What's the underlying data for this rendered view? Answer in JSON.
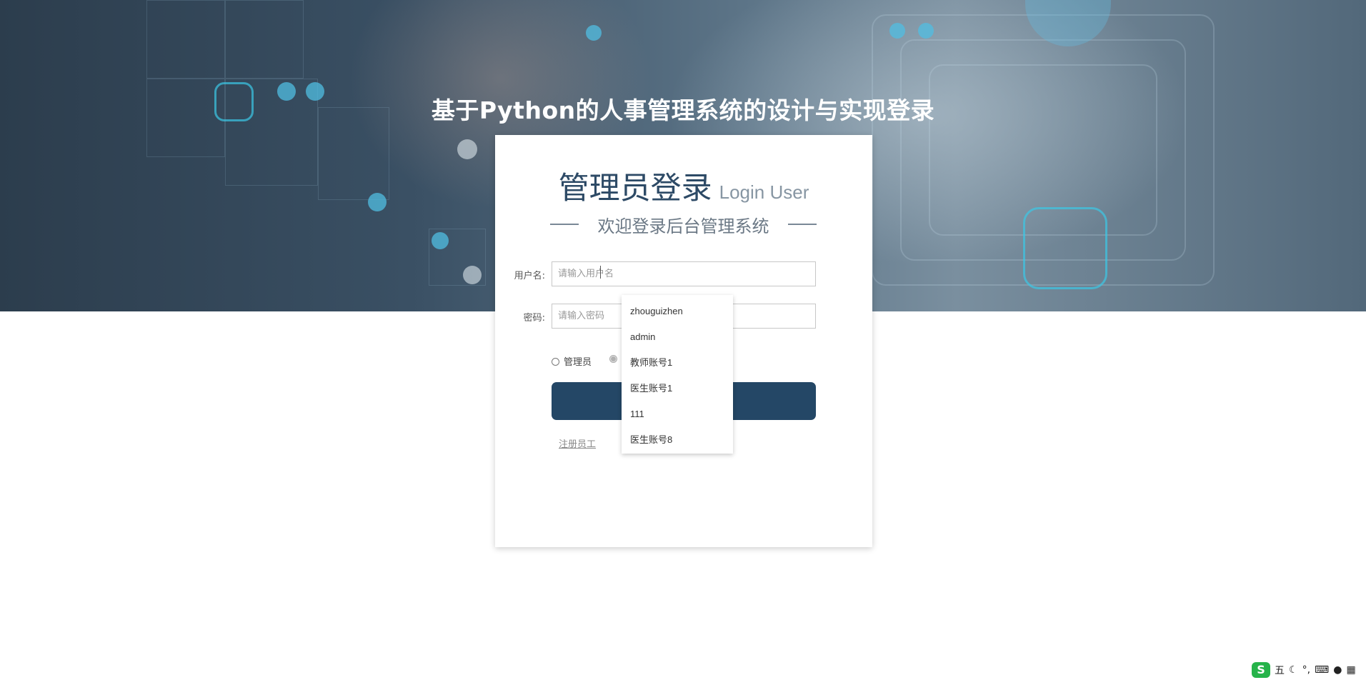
{
  "header": {
    "title": "基于Python的人事管理系统的设计与实现登录"
  },
  "card": {
    "title": "管理员登录",
    "title_en": "Login User",
    "subtitle": "欢迎登录后台管理系统"
  },
  "form": {
    "username_label": "用户名:",
    "username_placeholder": "请输入用户名",
    "password_label": "密码:",
    "password_placeholder": "请输入密码",
    "roles": [
      {
        "label": "管理员",
        "checked": false
      },
      {
        "label": "",
        "checked": true
      }
    ],
    "login_button": "",
    "register_link": "注册员工"
  },
  "autocomplete": {
    "options": [
      "zhouguizhen",
      "admin",
      "教师账号1",
      "医生账号1",
      "111",
      "医生账号8"
    ]
  },
  "ime": {
    "logo": "S",
    "mode": "五"
  }
}
